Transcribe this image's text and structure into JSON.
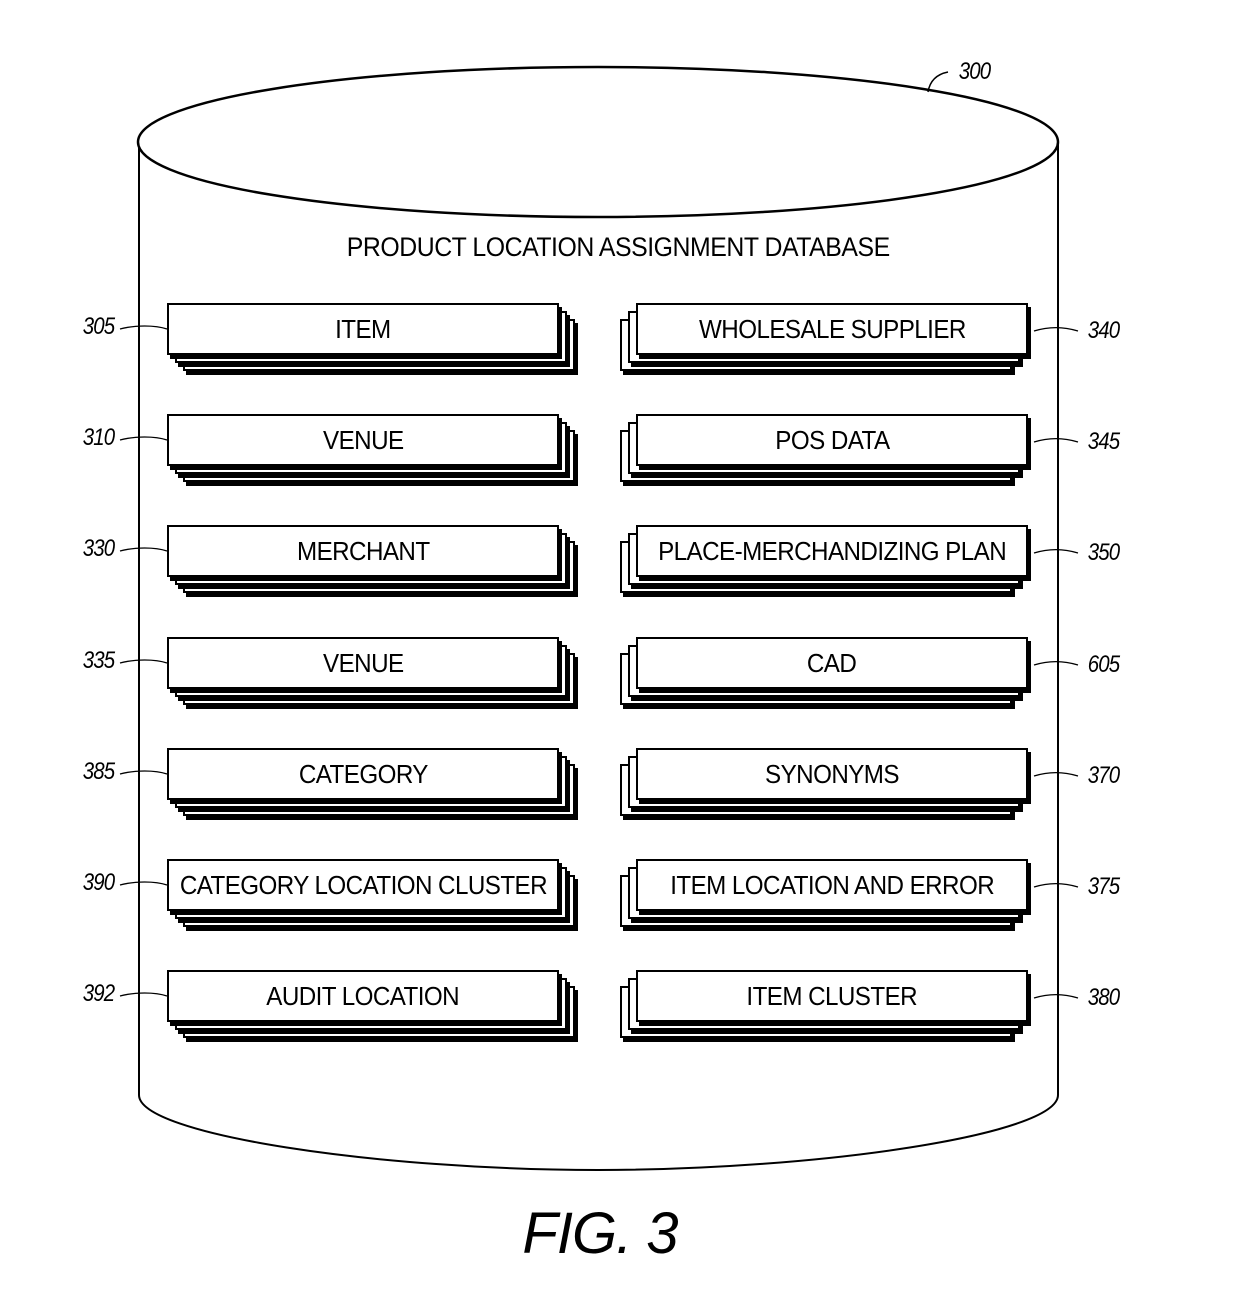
{
  "figure": {
    "label": "FIG. 3",
    "database_ref": "300",
    "database_title": "PRODUCT LOCATION ASSIGNMENT DATABASE"
  },
  "left_column": [
    {
      "label": "ITEM",
      "ref": "305"
    },
    {
      "label": "VENUE",
      "ref": "310"
    },
    {
      "label": "MERCHANT",
      "ref": "330"
    },
    {
      "label": "VENUE",
      "ref": "335"
    },
    {
      "label": "CATEGORY",
      "ref": "385"
    },
    {
      "label": "CATEGORY LOCATION CLUSTER",
      "ref": "390"
    },
    {
      "label": "AUDIT LOCATION",
      "ref": "392"
    }
  ],
  "right_column": [
    {
      "label": "WHOLESALE SUPPLIER",
      "ref": "340"
    },
    {
      "label": "POS DATA",
      "ref": "345"
    },
    {
      "label": "PLACE-MERCHANDIZING PLAN",
      "ref": "350"
    },
    {
      "label": "CAD",
      "ref": "605"
    },
    {
      "label": "SYNONYMS",
      "ref": "370"
    },
    {
      "label": "ITEM LOCATION AND ERROR",
      "ref": "375"
    },
    {
      "label": "ITEM CLUSTER",
      "ref": "380"
    }
  ]
}
